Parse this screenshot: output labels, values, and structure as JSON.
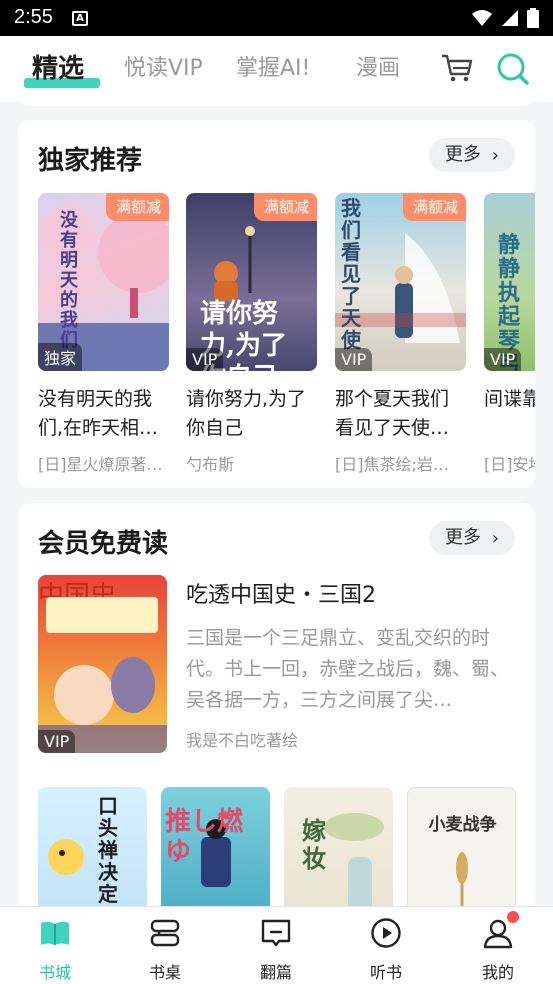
{
  "status": {
    "time": "2:55",
    "notif": "A"
  },
  "tabs": [
    {
      "label": "精选"
    },
    {
      "label": "悦读VIP"
    },
    {
      "label": "掌握AI!"
    },
    {
      "label": "漫画"
    }
  ],
  "exclusive": {
    "title": "独家推荐",
    "more": "更多",
    "books": [
      {
        "title": "没有明天的我们,在昨天相…",
        "author": "[日]星火燎原著…",
        "ribbon": "满额减",
        "badge": "独家",
        "cover_text": "没有明天的我们"
      },
      {
        "title": "请你努力,为了你自己",
        "author": "勺布斯",
        "ribbon": "满额减",
        "badge": "VIP",
        "cover_text": "请你努力,为了你自己"
      },
      {
        "title": "那个夏天我们看见了天使…",
        "author": "[日]焦茶绘;岩…",
        "ribbon": "满额减",
        "badge": "VIP",
        "cover_text": "我们看见了天使"
      },
      {
        "title": "间谍靠琴弓",
        "author": "[日]安地",
        "ribbon": "",
        "badge": "VIP",
        "cover_text": "静静执起琴弓"
      }
    ]
  },
  "member": {
    "title": "会员免费读",
    "more": "更多",
    "featured": {
      "title": "吃透中国史・三国2",
      "desc": "三国是一个三足鼎立、变乱交织的时代。书上一回，赤壁之战后，魏、蜀、吴各据一方，三方之间展了尖…",
      "author": "我是不白吃著绘",
      "badge": "VIP",
      "cover_text": "中国史"
    },
    "more_books": [
      {
        "cover_text": "口头禅决定人生"
      },
      {
        "cover_text": "推し燃ゆ"
      },
      {
        "cover_text": "嫁妆"
      },
      {
        "cover_text": "小麦战争"
      }
    ]
  },
  "bottom_nav": [
    {
      "label": "书城"
    },
    {
      "label": "书桌"
    },
    {
      "label": "翻篇"
    },
    {
      "label": "听书"
    },
    {
      "label": "我的"
    }
  ],
  "colors": {
    "accent": "#3fd2bd",
    "ribbon": "#ff8c69",
    "badge_dot": "#ff4d4f"
  }
}
